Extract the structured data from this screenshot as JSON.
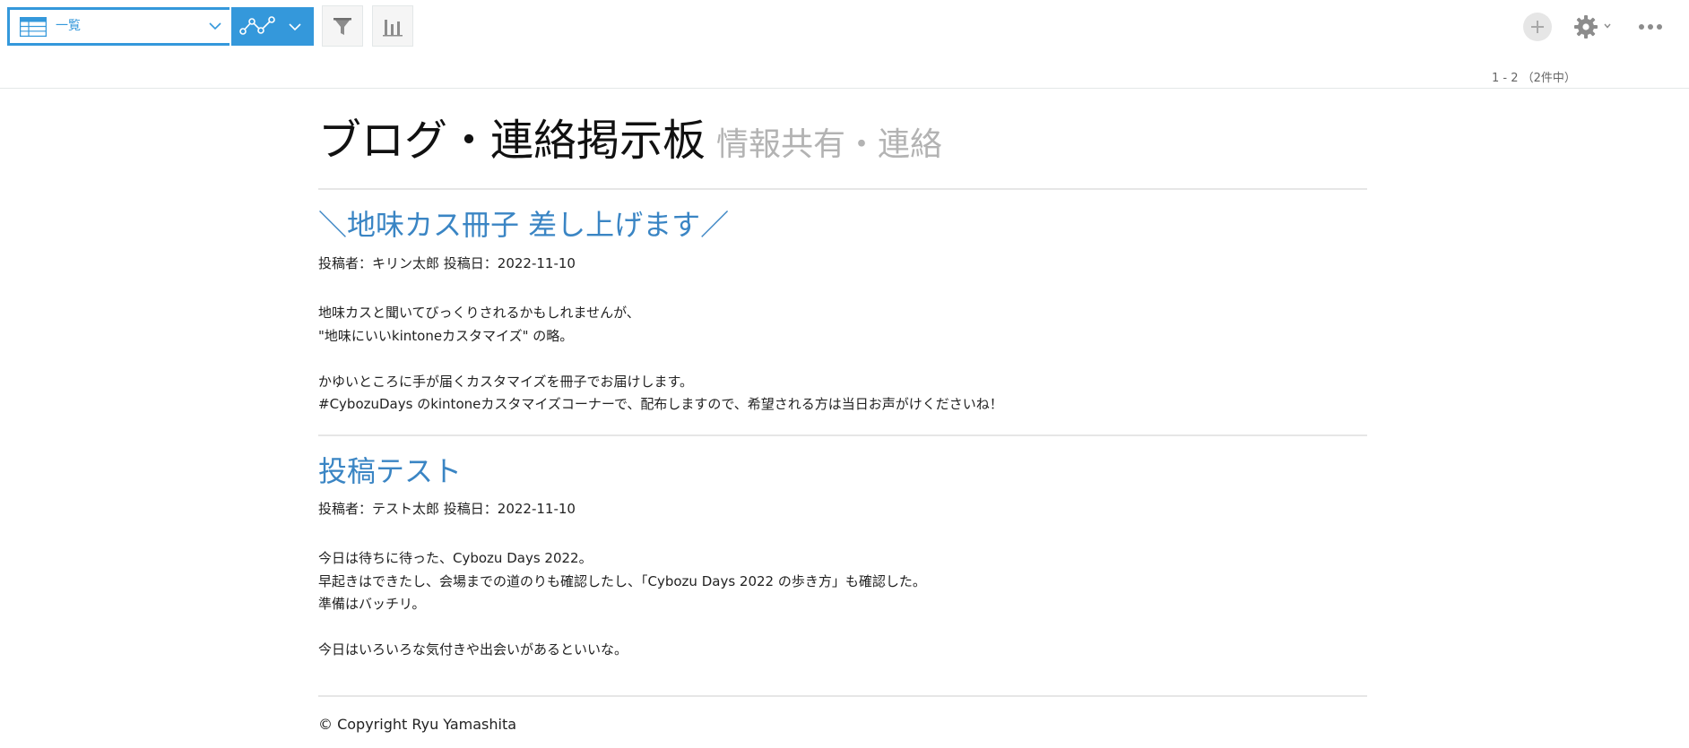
{
  "toolbar": {
    "view_label": "一覧",
    "pager": "1 - 2 （2件中）"
  },
  "page": {
    "title": "ブログ・連絡掲示板",
    "subtitle": "情報共有・連絡"
  },
  "posts": [
    {
      "title": "＼地味カス冊子 差し上げます／",
      "meta": "投稿者：キリン太郎 投稿日：2022-11-10",
      "paragraphs": [
        [
          "地味カスと聞いてびっくりされるかもしれませんが、",
          "\"地味にいいkintoneカスタマイズ\" の略。"
        ],
        [
          "かゆいところに手が届くカスタマイズを冊子でお届けします。",
          "#CybozuDays のkintoneカスタマイズコーナーで、配布しますので、希望される方は当日お声がけくださいね！"
        ]
      ]
    },
    {
      "title": "投稿テスト",
      "meta": "投稿者：テスト太郎 投稿日：2022-11-10",
      "paragraphs": [
        [
          "今日は待ちに待った、Cybozu Days 2022。",
          "早起きはできたし、会場までの道のりも確認したし、「Cybozu Days 2022 の歩き方」も確認した。",
          "準備はバッチリ。"
        ],
        [
          "今日はいろいろな気付きや出会いがあるといいな。"
        ]
      ]
    }
  ],
  "footer": {
    "copyright": "© Copyright Ryu Yamashita"
  },
  "colors": {
    "accent": "#3498db",
    "post_title": "#3a85c4",
    "subtitle": "#b3b3b3"
  },
  "icons": {
    "view": "table-icon",
    "graph": "graph-icon",
    "filter": "filter-icon",
    "chart": "bar-chart-icon",
    "add": "plus-icon",
    "settings": "gear-icon",
    "more": "more-icon"
  }
}
